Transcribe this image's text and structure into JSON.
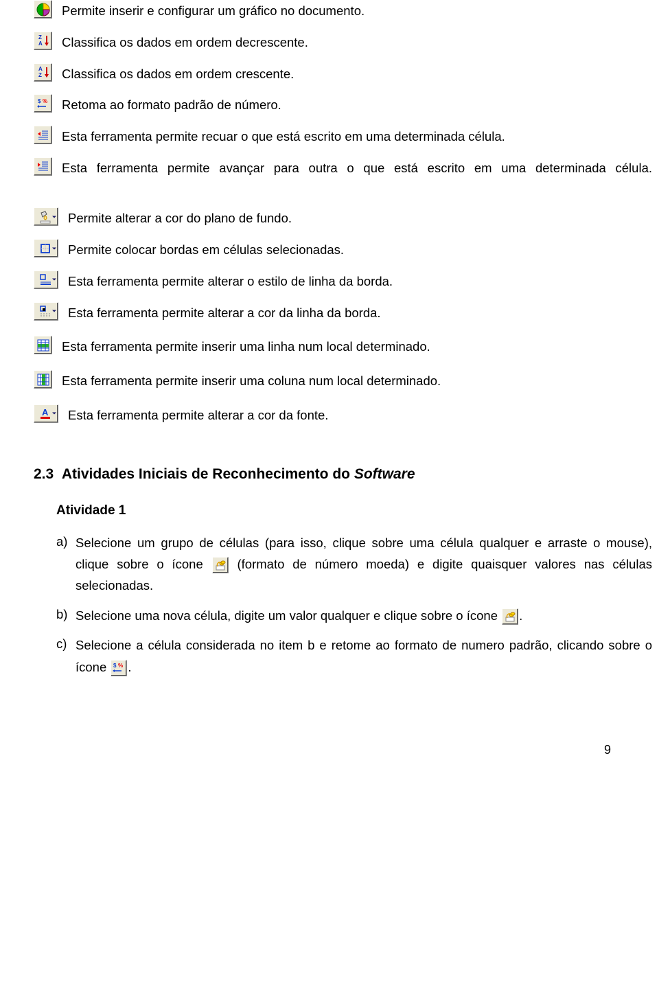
{
  "items": [
    {
      "icon": "chart",
      "text": "Permite inserir e configurar um gráfico no documento."
    },
    {
      "icon": "sort-desc",
      "text": "Classifica os dados em ordem decrescente."
    },
    {
      "icon": "sort-asc",
      "text": "Classifica os dados em ordem crescente."
    },
    {
      "icon": "number-default",
      "text": "Retoma ao formato padrão de número."
    },
    {
      "icon": "decrease-indent",
      "text": "Esta ferramenta permite recuar o que está escrito em uma determinada célula."
    },
    {
      "icon": "increase-indent",
      "text": "Esta ferramenta permite avançar para outra o que está escrito em uma determinada célula."
    },
    {
      "icon": "background-color",
      "text": "Permite alterar a cor do plano de fundo.",
      "wide": true
    },
    {
      "icon": "borders",
      "text": "Permite colocar bordas em células selecionadas.",
      "wide": true
    },
    {
      "icon": "line-style",
      "text": "Esta ferramenta permite alterar o estilo de linha da borda.",
      "wide": true
    },
    {
      "icon": "line-color",
      "text": "Esta ferramenta permite alterar a cor da linha da borda.",
      "wide": true
    },
    {
      "icon": "insert-row",
      "text": "Esta ferramenta permite inserir uma linha num local determinado."
    },
    {
      "icon": "insert-column",
      "text": "Esta ferramenta permite inserir uma coluna num local determinado."
    },
    {
      "icon": "font-color",
      "text": "Esta ferramenta permite alterar a cor da fonte.",
      "wide": true
    }
  ],
  "section": {
    "number": "2.3",
    "title": "Atividades Iniciais de Reconhecimento do ",
    "title_italic": "Software"
  },
  "activity": {
    "heading": "Atividade 1",
    "a_marker": "a)",
    "a_part1": "Selecione um grupo de células (para isso, clique sobre uma célula qualquer e arraste o mouse), clique sobre o ícone ",
    "a_part2": " (formato de número moeda) e digite quaisquer valores nas células selecionadas.",
    "b_marker": "b)",
    "b_part1": "Selecione uma nova célula, digite um valor qualquer e clique sobre o ícone ",
    "b_part2": ".",
    "c_marker": "c)",
    "c_part1": "Selecione a célula considerada no item b e retome ao formato de numero padrão, clicando sobre o ícone ",
    "c_part2": "."
  },
  "page_number": "9"
}
